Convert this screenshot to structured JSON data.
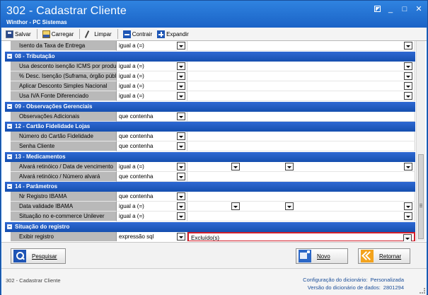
{
  "window": {
    "title": "302 - Cadastrar Cliente",
    "subtitle": "Winthor - PC Sistemas"
  },
  "toolbar": {
    "save_label": "Salvar",
    "load_label": "Carregar",
    "clear_label": "Limpar",
    "collapse_label": "Contrair",
    "expand_label": "Expandir"
  },
  "grid": {
    "top_row": {
      "label": "Isento da Taxa de Entrega",
      "operator": "igual a (=)"
    },
    "groups": [
      {
        "title": "08 - Tributação",
        "rows": [
          {
            "label": "Usa desconto isenção ICMS por produto",
            "operator": "igual a (=)"
          },
          {
            "label": "% Desc. Isenção (Suframa, órgão público)",
            "operator": "igual a (=)"
          },
          {
            "label": "Aplicar Desconto Simples Nacional",
            "operator": "igual a (=)"
          },
          {
            "label": "Usa IVA Fonte Diferenciado",
            "operator": "igual a (=)"
          }
        ]
      },
      {
        "title": "09 - Observações Gerenciais",
        "rows": [
          {
            "label": "Observações Adicionais",
            "operator": "que contenha"
          }
        ]
      },
      {
        "title": "12 - Cartão Fidelidade Lojas",
        "rows": [
          {
            "label": "Número do Cartão Fidelidade",
            "operator": "que contenha"
          },
          {
            "label": "Senha Cliente",
            "operator": "que contenha"
          }
        ]
      },
      {
        "title": "13 - Medicamentos",
        "rows": [
          {
            "label": "Alvará retinóico / Data de vencimento",
            "operator": "igual a (=)"
          },
          {
            "label": "Alvará retinóico / Número alvará",
            "operator": "que contenha"
          }
        ]
      },
      {
        "title": "14 - Parâmetros",
        "rows": [
          {
            "label": "Nr Registro IBAMA",
            "operator": "que contenha"
          },
          {
            "label": "Data validade IBAMA",
            "operator": "igual a (=)"
          },
          {
            "label": "Situação no e-commerce Unilever",
            "operator": "igual a (=)"
          }
        ]
      },
      {
        "title": "Situação do registro",
        "rows": [
          {
            "label": "Exibir registro",
            "operator": "expressão sql",
            "value": "Excluído(s)"
          }
        ]
      }
    ]
  },
  "buttons": {
    "search_label": "Pesquisar",
    "new_label": "Novo",
    "back_label": "Retornar"
  },
  "status": {
    "title": "302 - Cadastrar Cliente",
    "dict_config_label": "Configuração do dicionário:",
    "dict_config_value": "Personalizada",
    "dict_version_label": "Versão do dicionário de dados:",
    "dict_version_value": "2801294"
  }
}
